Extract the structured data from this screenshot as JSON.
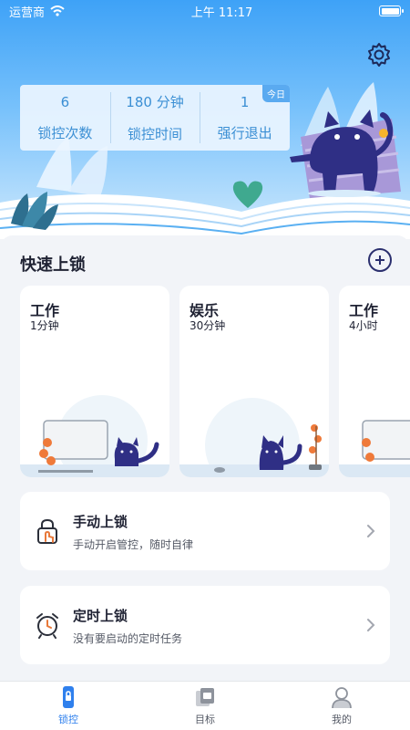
{
  "status_bar": {
    "carrier": "运营商",
    "time": "上午 11:17"
  },
  "stats": {
    "badge": "今日",
    "items": [
      {
        "value": "6",
        "label": "锁控次数"
      },
      {
        "value": "180 分钟",
        "label": "锁控时间"
      },
      {
        "value": "1",
        "label": "强行退出"
      }
    ]
  },
  "quick_lock": {
    "title": "快速上锁",
    "cards": [
      {
        "title": "工作",
        "duration": "1分钟"
      },
      {
        "title": "娱乐",
        "duration": "30分钟"
      },
      {
        "title": "工作",
        "duration": "4小时"
      }
    ]
  },
  "manual_lock": {
    "title": "手动上锁",
    "subtitle": "手动开启管控，随时自律"
  },
  "timed_lock": {
    "title": "定时上锁",
    "subtitle": "没有要启动的定时任务"
  },
  "tabbar": {
    "items": [
      {
        "label": "锁控",
        "icon": "phone-lock-icon",
        "active": true
      },
      {
        "label": "目标",
        "icon": "target-icon",
        "active": false
      },
      {
        "label": "我的",
        "icon": "profile-icon",
        "active": false
      }
    ]
  },
  "colors": {
    "accent": "#2f80ed",
    "sky_top": "#3ea2f7",
    "cat": "#2f2f85"
  }
}
